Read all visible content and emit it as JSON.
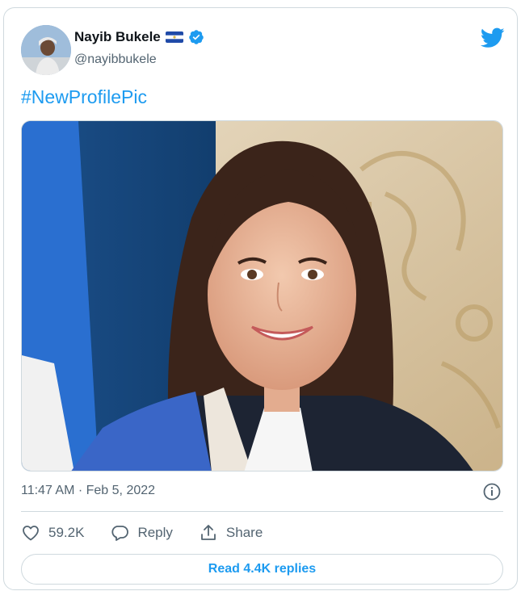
{
  "author": {
    "name": "Nayib Bukele",
    "handle": "@nayibbukele",
    "verified": true,
    "flag_icon": "el-salvador-flag-icon"
  },
  "tweet": {
    "text": "#NewProfilePic",
    "timestamp": "11:47 AM · Feb 5, 2022"
  },
  "actions": {
    "like_count": "59.2K",
    "reply_label": "Reply",
    "share_label": "Share"
  },
  "footer": {
    "read_replies_label": "Read 4.4K replies"
  },
  "colors": {
    "accent": "#1d9bf0",
    "text_primary": "#0f1419",
    "text_secondary": "#536471",
    "border": "#cfd9de"
  }
}
